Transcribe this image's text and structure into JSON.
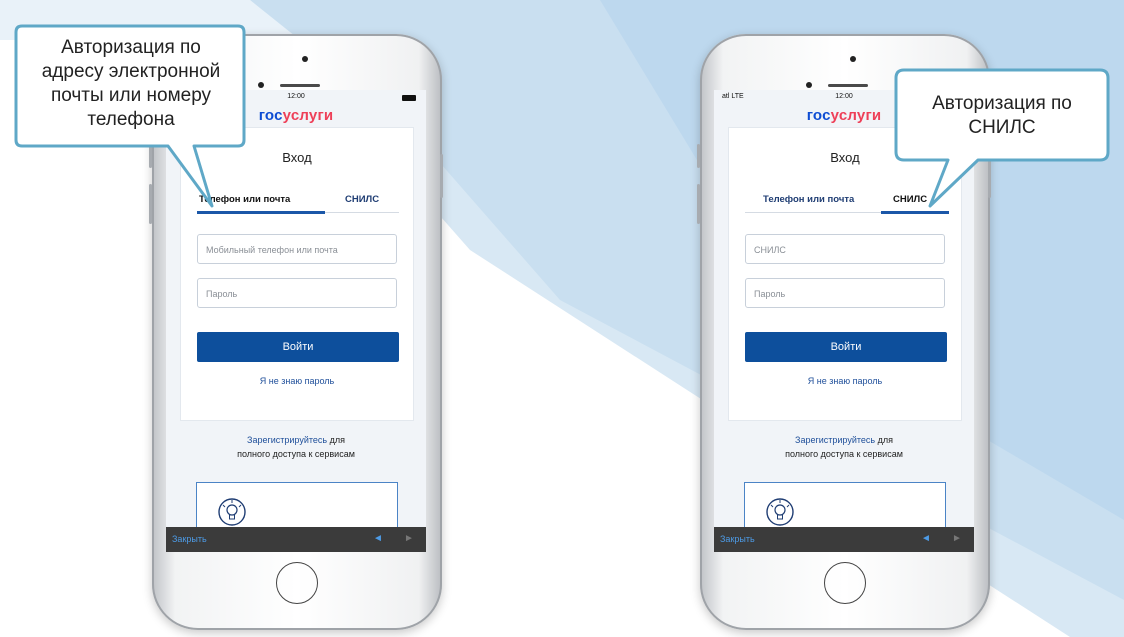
{
  "colors": {
    "background_stripe": "#c9dff0",
    "gos_blue": "#0d4cd3",
    "gos_red": "#ee3f58",
    "button_blue": "#0d4f9c",
    "link_blue": "#1f4f9a",
    "callout_border": "#5fa8c7"
  },
  "left_callout": {
    "line1": "Авторизация по",
    "line2": "адресу электронной",
    "line3": "почты или номеру",
    "line4": "телефона"
  },
  "right_callout": {
    "line1": "Авторизация по",
    "line2": "СНИЛС"
  },
  "left_phone": {
    "status_time": "12:00",
    "logo_part1": "гос",
    "logo_part2": "услуги",
    "title": "Вход",
    "tab1": "Телефон или почта",
    "tab2": "СНИЛС",
    "active_tab": "tab1",
    "field1_placeholder": "Мобильный телефон или почта",
    "field2_placeholder": "Пароль",
    "login_button": "Войти",
    "forgot_link": "Я не знаю пароль",
    "register_link": "Зарегистрируйтесь",
    "register_suffix": " для",
    "register_line2": "полного доступа к сервисам",
    "promo_icon": "lightbulb-icon",
    "close_label": "Закрыть",
    "prev_arrow": "◄",
    "next_arrow": "►"
  },
  "right_phone": {
    "status_signal": "atl LTE",
    "status_time": "12:00",
    "logo_part1": "гос",
    "logo_part2": "услуги",
    "title": "Вход",
    "tab1": "Телефон или почта",
    "tab2": "СНИЛС",
    "active_tab": "tab2",
    "field1_placeholder": "СНИЛС",
    "field2_placeholder": "Пароль",
    "login_button": "Войти",
    "forgot_link": "Я не знаю пароль",
    "register_link": "Зарегистрируйтесь",
    "register_suffix": " для",
    "register_line2": "полного доступа к сервисам",
    "promo_icon": "lightbulb-icon",
    "close_label": "Закрыть",
    "prev_arrow": "◄",
    "next_arrow": "►"
  }
}
